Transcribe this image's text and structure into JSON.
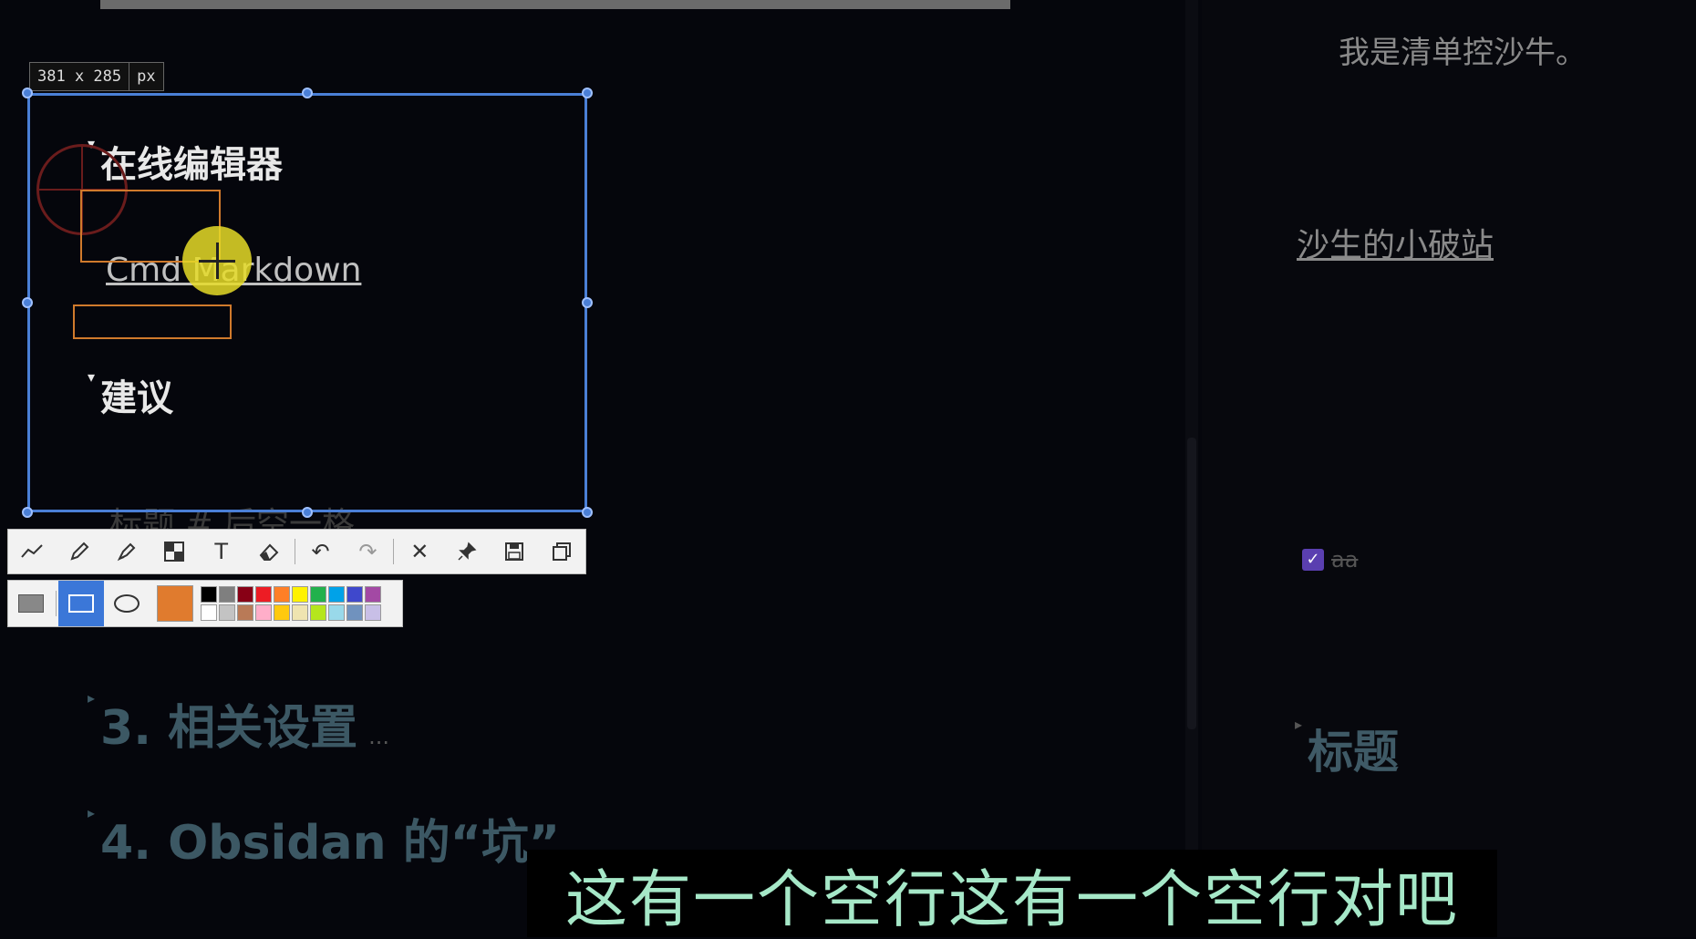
{
  "overlay": {
    "size_value": "381 x 285",
    "size_unit": "px"
  },
  "editor": {
    "online_editor_heading": "在线编辑器",
    "cmd_link": "Cmd Markdown",
    "suggest_heading": "建议",
    "faded_line": "标题 # 后空一格",
    "section3": "3. 相关设置",
    "section4": "4. Obsidan 的“坑”",
    "ellipsis": "..."
  },
  "right_pane": {
    "intro_text": "我是清单控沙牛。",
    "link": "沙生的小破站",
    "task_text": "aa",
    "heading": "标题"
  },
  "toolbar": {
    "tools": [
      "line-icon",
      "pencil-icon",
      "marker-icon",
      "mosaic-icon",
      "text-icon",
      "eraser-icon",
      "undo-icon",
      "redo-icon",
      "close-icon",
      "pin-icon",
      "save-icon",
      "copy-icon"
    ]
  },
  "palette": {
    "current_color": "#e07b2e",
    "colors": [
      "#000000",
      "#7f7f7f",
      "#880015",
      "#ed1c24",
      "#ff7f27",
      "#fff200",
      "#22b14c",
      "#00a2e8",
      "#3f48cc",
      "#a349a4",
      "#ffffff",
      "#c3c3c3",
      "#b97a57",
      "#ffaec9",
      "#ffc90e",
      "#efe4b0",
      "#b5e61d",
      "#99d9ea",
      "#7092be",
      "#c8bfe7"
    ]
  },
  "subtitle": "这有一个空行这有一个空行对吧"
}
